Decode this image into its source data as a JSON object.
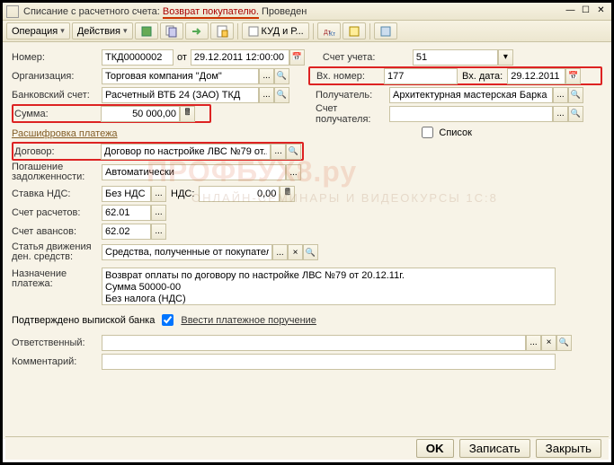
{
  "title": {
    "main": "Списание с расчетного счета:",
    "doc_type": "Возврат покупателю.",
    "status": "Проведен"
  },
  "toolbar": {
    "operation": "Операция",
    "actions": "Действия",
    "kudir": "КУД и Р..."
  },
  "labels": {
    "number": "Номер:",
    "from": "от",
    "account": "Счет учета:",
    "org": "Организация:",
    "in_number": "Вх. номер:",
    "in_date": "Вх. дата:",
    "bank_acc": "Банковский счет:",
    "recipient": "Получатель:",
    "sum": "Сумма:",
    "recip_acc": "Счет получателя:",
    "section": "Расшифровка платежа",
    "list": "Список",
    "contract": "Договор:",
    "repay": "Погашение задолженности:",
    "vat_rate": "Ставка НДС:",
    "vat": "НДС:",
    "calc_acc": "Счет расчетов:",
    "advance_acc": "Счет авансов:",
    "dd_item": "Статья движения ден. средств:",
    "payment_purpose": "Назначение платежа:",
    "confirmed": "Подтверждено выпиской банка",
    "enter_pp": "Ввести платежное поручение",
    "responsible": "Ответственный:",
    "comment": "Комментарий:"
  },
  "values": {
    "number": "ТКД0000002",
    "date": "29.12.2011 12:00:00",
    "account": "51",
    "org": "Торговая компания \"Дом\"",
    "in_number": "177",
    "in_date": "29.12.2011",
    "bank_acc": "Расчетный ВТБ 24 (ЗАО) ТКД",
    "recipient": "Архитектурная мастерская Барка",
    "sum": "50 000,00",
    "recip_acc": "",
    "contract": "Договор по настройке ЛВС №79 от...",
    "repay": "Автоматически",
    "vat_rate": "Без НДС",
    "vat": "0,00",
    "calc_acc": "62.01",
    "advance_acc": "62.02",
    "dd_item": "Средства, полученные от покупател",
    "payment_l1": "Возврат оплаты по договору  по настройке ЛВС №79 от 20.12.11г.",
    "payment_l2": "Сумма 50000-00",
    "payment_l3": "Без налога (НДС)",
    "responsible": "",
    "comment": ""
  },
  "buttons": {
    "ok": "OK",
    "write": "Записать",
    "close": "Закрыть"
  },
  "watermark": {
    "main": "ПРОФБУХ8.ру",
    "sub": "ОНЛАЙН-СЕМИНАРЫ И ВИДЕОКУРСЫ 1С:8"
  }
}
